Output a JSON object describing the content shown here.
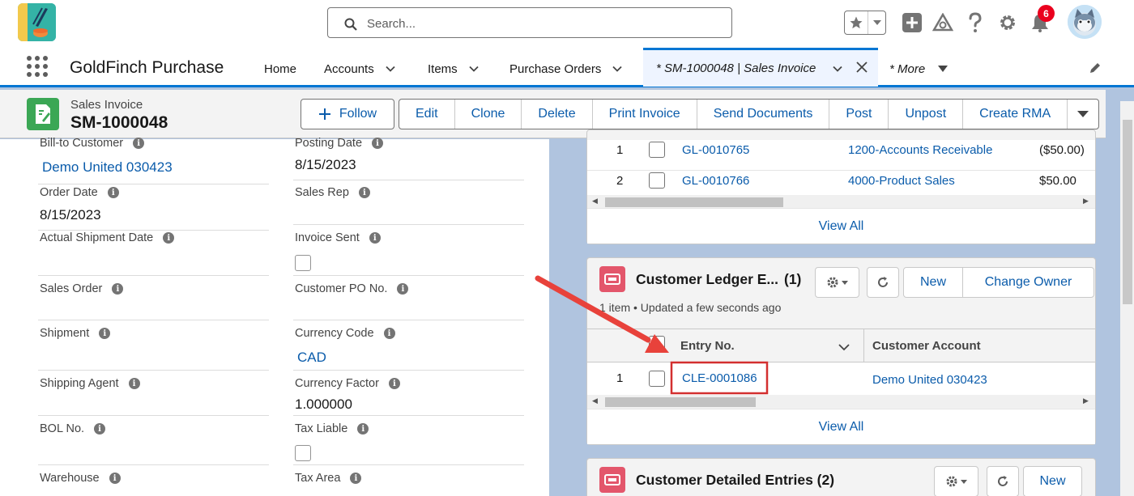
{
  "header": {
    "search_placeholder": "Search...",
    "notification_count": "6",
    "icons": [
      "app-logo-icon",
      "search-icon",
      "favorites-star-icon",
      "chevron-down-icon",
      "global-add-icon",
      "trailhead-icon",
      "help-icon",
      "setup-gear-icon",
      "notifications-bell-icon",
      "user-avatar"
    ]
  },
  "nav": {
    "app_name": "GoldFinch Purchase",
    "items": [
      {
        "label": "Home"
      },
      {
        "label": "Accounts"
      },
      {
        "label": "Items"
      },
      {
        "label": "Purchase Orders"
      }
    ],
    "active_tab": "* SM-1000048 | Sales Invoice",
    "more_label": "* More"
  },
  "highlights": {
    "record_type": "Sales Invoice",
    "record_name": "SM-1000048",
    "follow_label": "Follow",
    "actions": [
      "Edit",
      "Clone",
      "Delete",
      "Print Invoice",
      "Send Documents",
      "Post",
      "Unpost",
      "Create RMA"
    ]
  },
  "details": {
    "left": [
      {
        "label": "Bill-to Customer",
        "value": "Demo United 030423",
        "link": true
      },
      {
        "label": "Order Date",
        "value": "8/15/2023"
      },
      {
        "label": "Actual Shipment Date",
        "value": ""
      },
      {
        "label": "Sales Order",
        "value": ""
      },
      {
        "label": "Shipment",
        "value": ""
      },
      {
        "label": "Shipping Agent",
        "value": ""
      },
      {
        "label": "BOL No.",
        "value": ""
      },
      {
        "label": "Warehouse",
        "value": ""
      }
    ],
    "right": [
      {
        "label": "Posting Date",
        "value": "8/15/2023"
      },
      {
        "label": "Sales Rep",
        "value": ""
      },
      {
        "label": "Invoice Sent",
        "value": "",
        "checkbox": true
      },
      {
        "label": "Customer PO No.",
        "value": ""
      },
      {
        "label": "Currency Code",
        "value": "CAD",
        "link": true
      },
      {
        "label": "Currency Factor",
        "value": "1.000000"
      },
      {
        "label": "Tax Liable",
        "value": "",
        "checkbox": true
      },
      {
        "label": "Tax Area",
        "value": ""
      }
    ]
  },
  "gl_entries": {
    "rows": [
      {
        "num": "1",
        "entry": "GL-0010765",
        "account": "1200-Accounts Receivable",
        "amount": "($50.00)"
      },
      {
        "num": "2",
        "entry": "GL-0010766",
        "account": "4000-Product Sales",
        "amount": "$50.00"
      }
    ],
    "view_all": "View All"
  },
  "customer_ledger": {
    "title": "Customer Ledger E...",
    "count": "(1)",
    "meta": "1 item • Updated a few seconds ago",
    "new_label": "New",
    "change_owner_label": "Change Owner",
    "columns": [
      "Entry No.",
      "Customer Account"
    ],
    "rows": [
      {
        "num": "1",
        "entry": "CLE-0001086",
        "account": "Demo United 030423"
      }
    ],
    "view_all": "View All"
  },
  "customer_detailed": {
    "title": "Customer Detailed Entries (2)",
    "new_label": "New"
  },
  "annotation": {
    "arrow_color": "#e8423b",
    "highlight_color": "#d32f2f"
  },
  "colors": {
    "brand": "#0176d3",
    "link": "#0b5cab",
    "record_icon": "#3ba755",
    "related_icon": "#e3566b"
  }
}
